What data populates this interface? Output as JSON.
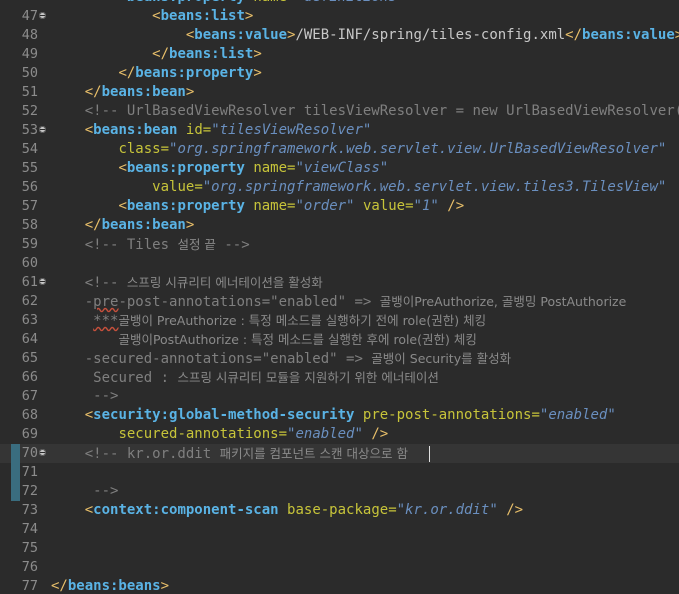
{
  "editor": {
    "lines": [
      {
        "n": "47",
        "fold": true,
        "segs": [
          [
            "ws",
            "            "
          ],
          [
            "punct",
            "<"
          ],
          [
            "tag",
            "beans:list"
          ],
          [
            "punct",
            ">"
          ]
        ]
      },
      {
        "n": "48",
        "segs": [
          [
            "ws",
            "                "
          ],
          [
            "punct",
            "<"
          ],
          [
            "tag",
            "beans:value"
          ],
          [
            "punct",
            ">"
          ],
          [
            "plain",
            "/WEB-INF/spring/tiles-config.xml"
          ],
          [
            "punct",
            "</"
          ],
          [
            "tag",
            "beans:value"
          ],
          [
            "punct",
            ">"
          ]
        ]
      },
      {
        "n": "49",
        "segs": [
          [
            "ws",
            "            "
          ],
          [
            "punct",
            "</"
          ],
          [
            "tag",
            "beans:list"
          ],
          [
            "punct",
            ">"
          ]
        ]
      },
      {
        "n": "50",
        "segs": [
          [
            "ws",
            "        "
          ],
          [
            "punct",
            "</"
          ],
          [
            "tag",
            "beans:property"
          ],
          [
            "punct",
            ">"
          ]
        ]
      },
      {
        "n": "51",
        "segs": [
          [
            "ws",
            "    "
          ],
          [
            "punct",
            "</"
          ],
          [
            "tag",
            "beans:bean"
          ],
          [
            "punct",
            ">"
          ]
        ]
      },
      {
        "n": "52",
        "segs": [
          [
            "ws",
            "    "
          ],
          [
            "comment",
            "<!-- UrlBasedViewResolver tilesViewResolver = new UrlBasedViewResolver();"
          ]
        ]
      },
      {
        "n": "53",
        "fold": true,
        "segs": [
          [
            "ws",
            "    "
          ],
          [
            "punct",
            "<"
          ],
          [
            "tag",
            "beans:bean"
          ],
          [
            "plain",
            " "
          ],
          [
            "attr",
            "id"
          ],
          [
            "eq",
            "="
          ],
          [
            "val",
            "\"tilesViewResolver\""
          ]
        ]
      },
      {
        "n": "54",
        "segs": [
          [
            "ws",
            "        "
          ],
          [
            "attr",
            "class"
          ],
          [
            "eq",
            "="
          ],
          [
            "val",
            "\"org.springframework.web.servlet.view.UrlBasedViewResolver\""
          ]
        ]
      },
      {
        "n": "55",
        "segs": [
          [
            "ws",
            "        "
          ],
          [
            "punct",
            "<"
          ],
          [
            "tag",
            "beans:property"
          ],
          [
            "plain",
            " "
          ],
          [
            "attr",
            "name"
          ],
          [
            "eq",
            "="
          ],
          [
            "val",
            "\"viewClass\""
          ]
        ]
      },
      {
        "n": "56",
        "segs": [
          [
            "ws",
            "            "
          ],
          [
            "attr",
            "value"
          ],
          [
            "eq",
            "="
          ],
          [
            "val",
            "\"org.springframework.web.servlet.view.tiles3.TilesView\""
          ]
        ]
      },
      {
        "n": "57",
        "segs": [
          [
            "ws",
            "        "
          ],
          [
            "punct",
            "<"
          ],
          [
            "tag",
            "beans:property"
          ],
          [
            "plain",
            " "
          ],
          [
            "attr",
            "name"
          ],
          [
            "eq",
            "="
          ],
          [
            "val",
            "\"order\""
          ],
          [
            "plain",
            " "
          ],
          [
            "attr",
            "value"
          ],
          [
            "eq",
            "="
          ],
          [
            "val",
            "\"1\""
          ],
          [
            "plain",
            " "
          ],
          [
            "punct",
            "/>"
          ]
        ]
      },
      {
        "n": "58",
        "segs": [
          [
            "ws",
            "    "
          ],
          [
            "punct",
            "</"
          ],
          [
            "tag",
            "beans:bean"
          ],
          [
            "punct",
            ">"
          ]
        ]
      },
      {
        "n": "59",
        "segs": [
          [
            "ws",
            "    "
          ],
          [
            "comment",
            "<!-- Tiles "
          ],
          [
            "commentko",
            "설정 끝"
          ],
          [
            "comment",
            " -->"
          ]
        ]
      },
      {
        "n": "60",
        "segs": []
      },
      {
        "n": "61",
        "fold": true,
        "segs": [
          [
            "ws",
            "    "
          ],
          [
            "comment",
            "<!-- "
          ],
          [
            "commentko",
            "스프링 시큐리티 에너테이션을 활성화"
          ]
        ]
      },
      {
        "n": "62",
        "segs": [
          [
            "ws",
            "    "
          ],
          [
            "comment",
            "-"
          ],
          [
            "squiggle",
            "pre"
          ],
          [
            "comment",
            "-post-annotations=\"enabled\" => "
          ],
          [
            "commentko",
            "골뱅이PreAuthorize, 골뱅밍 PostAuthorize"
          ]
        ]
      },
      {
        "n": "63",
        "segs": [
          [
            "ws",
            "     "
          ],
          [
            "squiggle",
            "***"
          ],
          [
            "commentko",
            "골뱅이 PreAuthorize : 특정 메소드를 실행하기 전에 role(권한) 체킹"
          ]
        ]
      },
      {
        "n": "64",
        "segs": [
          [
            "ws",
            "        "
          ],
          [
            "commentko",
            "골뱅이PostAuthorize : 특정 메소드를 실행한 후에 role(권한) 체킹"
          ]
        ]
      },
      {
        "n": "65",
        "segs": [
          [
            "ws",
            "    "
          ],
          [
            "comment",
            "-secured-annotations=\"enabled\" => "
          ],
          [
            "commentko",
            "골뱅이 Security를 활성화"
          ]
        ]
      },
      {
        "n": "66",
        "segs": [
          [
            "ws",
            "     "
          ],
          [
            "comment",
            "Secured : "
          ],
          [
            "commentko",
            "스프링 시큐리티 모듈을 지원하기 위한 에너테이션"
          ]
        ]
      },
      {
        "n": "67",
        "segs": [
          [
            "ws",
            "     "
          ],
          [
            "comment",
            "-->"
          ]
        ]
      },
      {
        "n": "68",
        "segs": [
          [
            "ws",
            "    "
          ],
          [
            "punct",
            "<"
          ],
          [
            "tag",
            "security:global-method-security"
          ],
          [
            "plain",
            " "
          ],
          [
            "attr",
            "pre-post-annotations"
          ],
          [
            "eq",
            "="
          ],
          [
            "val",
            "\"enabled\""
          ]
        ]
      },
      {
        "n": "69",
        "segs": [
          [
            "ws",
            "        "
          ],
          [
            "attr",
            "secured-annotations"
          ],
          [
            "eq",
            "="
          ],
          [
            "val",
            "\"enabled\""
          ],
          [
            "plain",
            " "
          ],
          [
            "punct",
            "/>"
          ]
        ]
      },
      {
        "n": "70",
        "fold": true,
        "current": true,
        "marker": true,
        "segs": [
          [
            "ws",
            "    "
          ],
          [
            "comment",
            "<!-- kr.or.ddit "
          ],
          [
            "commentko",
            "패키지를 컴포넌트 스캔 대상으로 함"
          ]
        ]
      },
      {
        "n": "71",
        "marker": true,
        "segs": []
      },
      {
        "n": "72",
        "marker": true,
        "segs": [
          [
            "ws",
            "     "
          ],
          [
            "comment",
            "-->"
          ]
        ]
      },
      {
        "n": "73",
        "segs": [
          [
            "ws",
            "    "
          ],
          [
            "punct",
            "<"
          ],
          [
            "tag",
            "context:component-scan"
          ],
          [
            "plain",
            " "
          ],
          [
            "attr",
            "base-package"
          ],
          [
            "eq",
            "="
          ],
          [
            "val",
            "\"kr.or.ddit\""
          ],
          [
            "plain",
            " "
          ],
          [
            "punct",
            "/>"
          ]
        ]
      },
      {
        "n": "74",
        "segs": []
      },
      {
        "n": "75",
        "segs": []
      },
      {
        "n": "76",
        "segs": []
      },
      {
        "n": "77",
        "segs": [
          [
            "punct",
            "</"
          ],
          [
            "tag",
            "beans:beans"
          ],
          [
            "punct",
            ">"
          ]
        ]
      }
    ],
    "partial_top_line": {
      "segs": [
        [
          "ws",
          "        "
        ],
        [
          "punct",
          "<"
        ],
        [
          "tag",
          "beans:property"
        ],
        [
          "plain",
          " "
        ],
        [
          "attr",
          "name"
        ],
        [
          "eq",
          "="
        ],
        [
          "val",
          "\"definitions\""
        ],
        [
          "punct",
          ">"
        ]
      ]
    },
    "colors": {
      "background": "#2b2b2b",
      "tag": "#5ab3e5",
      "attribute": "#c7c43a",
      "value": "#6a8fbf",
      "bracket": "#e8bf6a",
      "comment": "#7f7f7f",
      "line_number": "#8c8c8c",
      "current_line": "#353535",
      "change_marker": "#3a6d7f"
    }
  }
}
